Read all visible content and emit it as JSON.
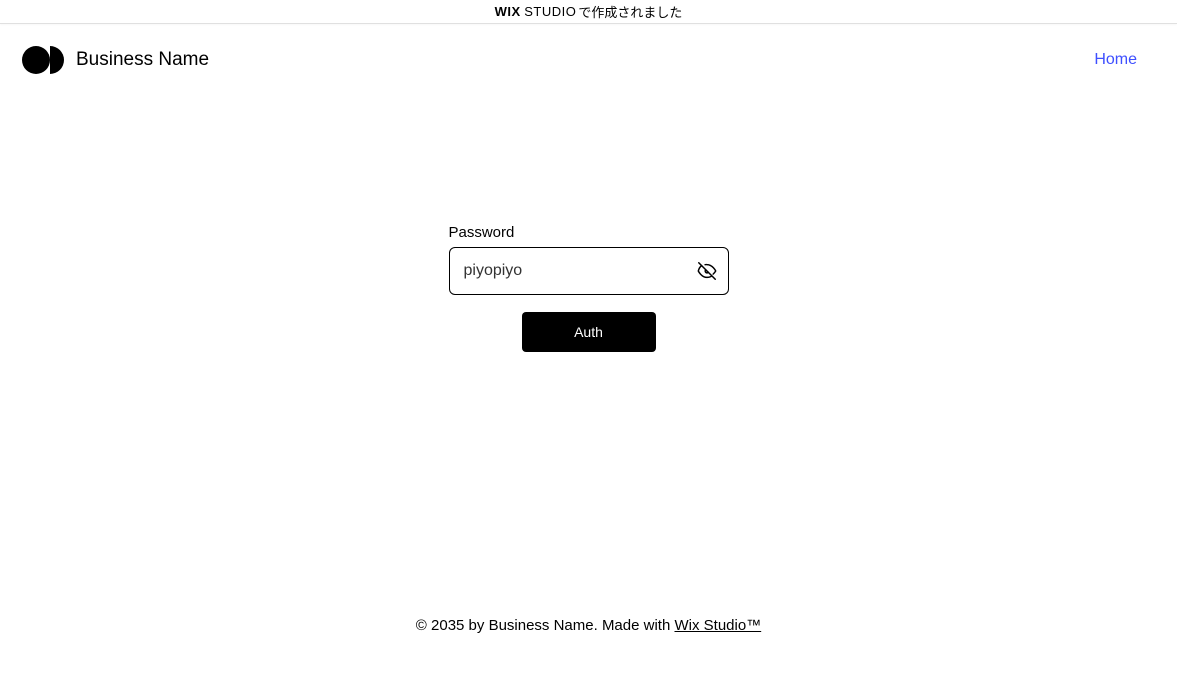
{
  "banner": {
    "wix": "WIX",
    "studio": "STUDIO",
    "tail": " で作成されました"
  },
  "header": {
    "brand": "Business Name",
    "home": "Home"
  },
  "form": {
    "password_label": "Password",
    "password_value": "piyopiyo",
    "auth_label": "Auth"
  },
  "footer": {
    "prefix": "© 2035 by Business Name. Made with ",
    "link_text": "Wix Studio™"
  }
}
